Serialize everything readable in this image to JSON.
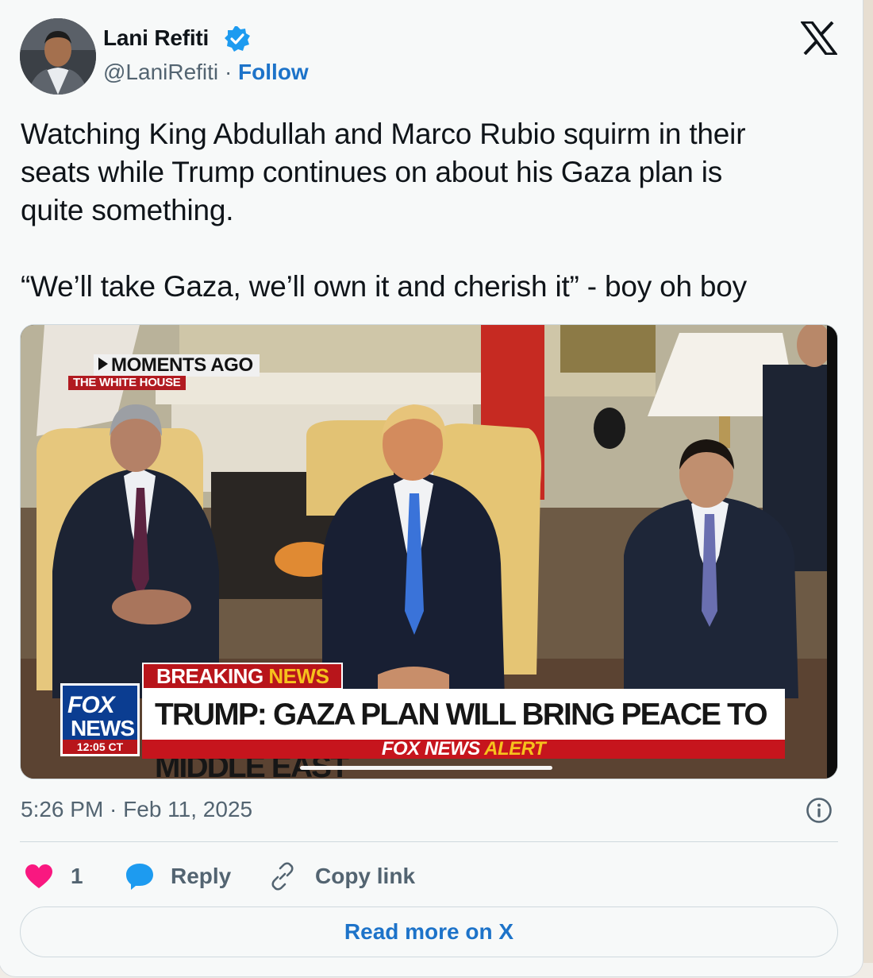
{
  "author": {
    "name": "Lani Refiti",
    "handle": "@LaniRefiti",
    "separator": "·",
    "follow_label": "Follow"
  },
  "tweet": {
    "text": "Watching King Abdullah and Marco Rubio squirm in their\nseats while Trump continues on about his Gaza plan is\nquite something.\n\n“We’ll take Gaza, we’ll own it and cherish it” - boy oh boy",
    "timestamp": "5:26 PM · Feb 11, 2025"
  },
  "media": {
    "moments_label": "MOMENTS AGO",
    "location_label": "THE WHITE HOUSE",
    "breaking_label": "BREAKING",
    "breaking_news_word": "NEWS",
    "logo_line1": "FOX",
    "logo_line2": "NEWS",
    "clock": "12:05 CT",
    "headline": "TRUMP: GAZA PLAN WILL BRING PEACE TO MIDDLE EAST",
    "alert_prefix": "FOX NEWS",
    "alert_word": "ALERT",
    "progress": 0.3
  },
  "actions": {
    "like_count": "1",
    "reply_label": "Reply",
    "copy_label": "Copy link"
  },
  "read_more_label": "Read more on X",
  "colors": {
    "accent": "#1d73c9",
    "heart": "#f91880",
    "fox_red": "#b8151b",
    "fox_blue": "#0b3d91"
  }
}
